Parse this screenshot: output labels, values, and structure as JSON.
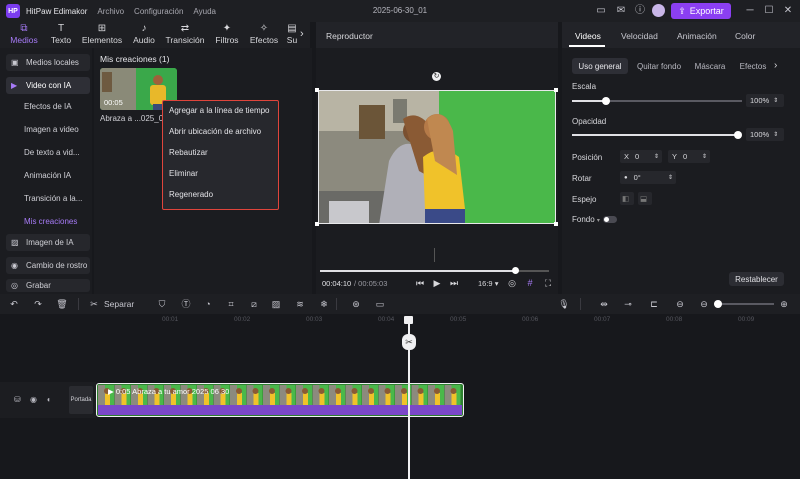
{
  "titlebar": {
    "app_name": "HitPaw Edimakor",
    "menu": [
      "Archivo",
      "Configuración",
      "Ayuda"
    ],
    "doc_title": "2025-06-30_01",
    "export_label": "Exportar"
  },
  "tool_tabs": [
    {
      "label": "Medios",
      "icon": "media-icon"
    },
    {
      "label": "Texto",
      "icon": "text-icon"
    },
    {
      "label": "Elementos",
      "icon": "elements-icon"
    },
    {
      "label": "Audio",
      "icon": "music-note-icon"
    },
    {
      "label": "Transición",
      "icon": "transition-icon"
    },
    {
      "label": "Filtros",
      "icon": "sparkle-icon"
    },
    {
      "label": "Efectos",
      "icon": "effects-icon"
    },
    {
      "label": "Su",
      "icon": "subtitle-icon"
    }
  ],
  "sidebar": {
    "items": [
      {
        "label": "Medios locales",
        "type": "group"
      },
      {
        "label": "Video con IA",
        "type": "group-active"
      },
      {
        "label": "Efectos de IA",
        "type": "sub"
      },
      {
        "label": "Imagen a video",
        "type": "sub"
      },
      {
        "label": "De texto a vid...",
        "type": "sub"
      },
      {
        "label": "Animación IA",
        "type": "sub"
      },
      {
        "label": "Transición a la...",
        "type": "sub"
      },
      {
        "label": "Mis creaciones",
        "type": "sub-current"
      },
      {
        "label": "Imagen de IA",
        "type": "group"
      },
      {
        "label": "Cambio de rostro",
        "type": "group"
      },
      {
        "label": "Grabar",
        "type": "group"
      }
    ]
  },
  "media": {
    "title": "Mis creaciones (1)",
    "thumb_duration": "00:05",
    "thumb_label": "Abraza a ...025_06_"
  },
  "context_menu": [
    "Agregar a la línea de tiempo",
    "Abrir ubicación de archivo",
    "Rebautizar",
    "Eliminar",
    "Regenerado"
  ],
  "player": {
    "title": "Reproductor",
    "current_time": "00:04:10",
    "total_time": "/ 00:05:03",
    "aspect_ratio": "16:9",
    "progress_fraction": 0.85
  },
  "properties": {
    "tabs": [
      "Videos",
      "Velocidad",
      "Animación",
      "Color"
    ],
    "subtabs": [
      "Uso general",
      "Quitar fondo",
      "Máscara",
      "Efectos"
    ],
    "scale_label": "Escala",
    "scale_value": "100%",
    "opacity_label": "Opacidad",
    "opacity_value": "100%",
    "position_label": "Posición",
    "pos_x_label": "X",
    "pos_x": "0",
    "pos_y_label": "Y",
    "pos_y": "0",
    "rotate_label": "Rotar",
    "rotate_value": "0°",
    "mirror_label": "Espejo",
    "background_label": "Fondo",
    "reset_label": "Restablecer"
  },
  "timeline": {
    "split_label": "Separar",
    "ticks": [
      "00:01",
      "00:02",
      "00:03",
      "00:04",
      "00:05",
      "00:06",
      "00:07",
      "00:08",
      "00:09"
    ],
    "cover_label": "Portada",
    "clip_label": "0:05 Abraza a tu amor 2025 06 30"
  },
  "colors": {
    "accent": "#8b3ff2",
    "green_screen": "#4ab84a",
    "highlight_border": "#e0453c"
  }
}
